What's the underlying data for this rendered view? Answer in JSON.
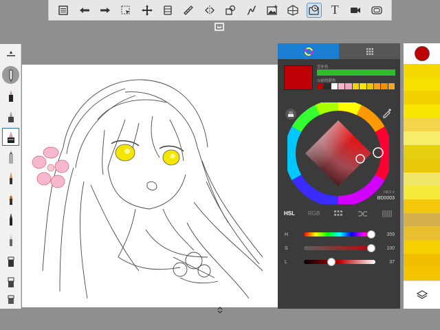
{
  "toolbar": {
    "icons": [
      "menu-icon",
      "undo-icon",
      "redo-icon",
      "select-icon",
      "transform-icon",
      "layers-icon",
      "ruler-icon",
      "symmetry-icon",
      "shapes-icon",
      "curve-icon",
      "image-import-icon",
      "perspective-icon",
      "tracing-icon",
      "text-icon",
      "video-icon",
      "fullscreen-icon"
    ],
    "active": "tracing-icon",
    "text_label": "T"
  },
  "brushes": [
    "move",
    "pencil",
    "ink",
    "airbrush",
    "marker",
    "fill",
    "pen",
    "brush",
    "brush2",
    "calligraphy",
    "paint",
    "eraser",
    "eraser2"
  ],
  "selected_brush": 4,
  "color_panel": {
    "complementary_label": "互补色",
    "complementary_color": "#2EBC2E",
    "history_label": "以前的颜色",
    "history_colors": [
      "#BD0003",
      "#2a2a2a",
      "#ffffff",
      "#f7b6c8",
      "#f2a5c0",
      "#f5d400",
      "#f7e300",
      "#e8c800",
      "#f4a020",
      "#f29000",
      "#f5a623"
    ],
    "current_color": "#BD0003",
    "hex_label": "HEX #",
    "hex_value": "BD0003",
    "modes": {
      "hsl": "HSL",
      "rgb": "RGB"
    },
    "sliders": [
      {
        "label": "H",
        "value": "359",
        "fraction": 0.997
      },
      {
        "label": "S",
        "value": "100",
        "fraction": 1.0
      },
      {
        "label": "L",
        "value": "37",
        "fraction": 0.37
      }
    ]
  },
  "palette": {
    "current": "#BD0003",
    "swatches": [
      "#f5d800",
      "#f7e000",
      "#f0d000",
      "#f9e600",
      "#f5d44a",
      "#f7ef6a",
      "#e5d010",
      "#e9c80a",
      "#f0e66a",
      "#f7ea3a",
      "#f3c80a",
      "#d4b04a",
      "#e8bf30",
      "#f5d000",
      "#f2be00",
      "#f5c400"
    ]
  }
}
